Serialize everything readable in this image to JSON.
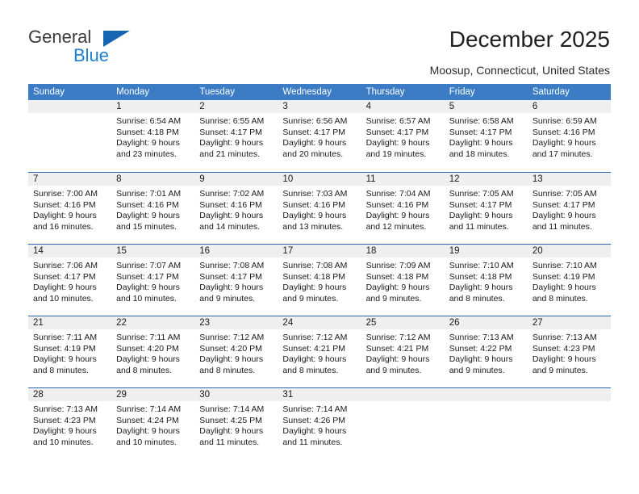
{
  "brand": {
    "name_part1": "General",
    "name_part2": "Blue",
    "accent_color": "#1b7fd4",
    "triangle_color": "#1565b0"
  },
  "header": {
    "title": "December 2025",
    "location": "Moosup, Connecticut, United States"
  },
  "calendar": {
    "header_bg": "#3b7cc4",
    "header_text_color": "#ffffff",
    "day_band_bg": "#efefef",
    "weekdays": [
      "Sunday",
      "Monday",
      "Tuesday",
      "Wednesday",
      "Thursday",
      "Friday",
      "Saturday"
    ],
    "weeks": [
      [
        {
          "number": "",
          "sunrise": "",
          "sunset": "",
          "daylight_line1": "",
          "daylight_line2": ""
        },
        {
          "number": "1",
          "sunrise": "Sunrise: 6:54 AM",
          "sunset": "Sunset: 4:18 PM",
          "daylight_line1": "Daylight: 9 hours",
          "daylight_line2": "and 23 minutes."
        },
        {
          "number": "2",
          "sunrise": "Sunrise: 6:55 AM",
          "sunset": "Sunset: 4:17 PM",
          "daylight_line1": "Daylight: 9 hours",
          "daylight_line2": "and 21 minutes."
        },
        {
          "number": "3",
          "sunrise": "Sunrise: 6:56 AM",
          "sunset": "Sunset: 4:17 PM",
          "daylight_line1": "Daylight: 9 hours",
          "daylight_line2": "and 20 minutes."
        },
        {
          "number": "4",
          "sunrise": "Sunrise: 6:57 AM",
          "sunset": "Sunset: 4:17 PM",
          "daylight_line1": "Daylight: 9 hours",
          "daylight_line2": "and 19 minutes."
        },
        {
          "number": "5",
          "sunrise": "Sunrise: 6:58 AM",
          "sunset": "Sunset: 4:17 PM",
          "daylight_line1": "Daylight: 9 hours",
          "daylight_line2": "and 18 minutes."
        },
        {
          "number": "6",
          "sunrise": "Sunrise: 6:59 AM",
          "sunset": "Sunset: 4:16 PM",
          "daylight_line1": "Daylight: 9 hours",
          "daylight_line2": "and 17 minutes."
        }
      ],
      [
        {
          "number": "7",
          "sunrise": "Sunrise: 7:00 AM",
          "sunset": "Sunset: 4:16 PM",
          "daylight_line1": "Daylight: 9 hours",
          "daylight_line2": "and 16 minutes."
        },
        {
          "number": "8",
          "sunrise": "Sunrise: 7:01 AM",
          "sunset": "Sunset: 4:16 PM",
          "daylight_line1": "Daylight: 9 hours",
          "daylight_line2": "and 15 minutes."
        },
        {
          "number": "9",
          "sunrise": "Sunrise: 7:02 AM",
          "sunset": "Sunset: 4:16 PM",
          "daylight_line1": "Daylight: 9 hours",
          "daylight_line2": "and 14 minutes."
        },
        {
          "number": "10",
          "sunrise": "Sunrise: 7:03 AM",
          "sunset": "Sunset: 4:16 PM",
          "daylight_line1": "Daylight: 9 hours",
          "daylight_line2": "and 13 minutes."
        },
        {
          "number": "11",
          "sunrise": "Sunrise: 7:04 AM",
          "sunset": "Sunset: 4:16 PM",
          "daylight_line1": "Daylight: 9 hours",
          "daylight_line2": "and 12 minutes."
        },
        {
          "number": "12",
          "sunrise": "Sunrise: 7:05 AM",
          "sunset": "Sunset: 4:17 PM",
          "daylight_line1": "Daylight: 9 hours",
          "daylight_line2": "and 11 minutes."
        },
        {
          "number": "13",
          "sunrise": "Sunrise: 7:05 AM",
          "sunset": "Sunset: 4:17 PM",
          "daylight_line1": "Daylight: 9 hours",
          "daylight_line2": "and 11 minutes."
        }
      ],
      [
        {
          "number": "14",
          "sunrise": "Sunrise: 7:06 AM",
          "sunset": "Sunset: 4:17 PM",
          "daylight_line1": "Daylight: 9 hours",
          "daylight_line2": "and 10 minutes."
        },
        {
          "number": "15",
          "sunrise": "Sunrise: 7:07 AM",
          "sunset": "Sunset: 4:17 PM",
          "daylight_line1": "Daylight: 9 hours",
          "daylight_line2": "and 10 minutes."
        },
        {
          "number": "16",
          "sunrise": "Sunrise: 7:08 AM",
          "sunset": "Sunset: 4:17 PM",
          "daylight_line1": "Daylight: 9 hours",
          "daylight_line2": "and 9 minutes."
        },
        {
          "number": "17",
          "sunrise": "Sunrise: 7:08 AM",
          "sunset": "Sunset: 4:18 PM",
          "daylight_line1": "Daylight: 9 hours",
          "daylight_line2": "and 9 minutes."
        },
        {
          "number": "18",
          "sunrise": "Sunrise: 7:09 AM",
          "sunset": "Sunset: 4:18 PM",
          "daylight_line1": "Daylight: 9 hours",
          "daylight_line2": "and 9 minutes."
        },
        {
          "number": "19",
          "sunrise": "Sunrise: 7:10 AM",
          "sunset": "Sunset: 4:18 PM",
          "daylight_line1": "Daylight: 9 hours",
          "daylight_line2": "and 8 minutes."
        },
        {
          "number": "20",
          "sunrise": "Sunrise: 7:10 AM",
          "sunset": "Sunset: 4:19 PM",
          "daylight_line1": "Daylight: 9 hours",
          "daylight_line2": "and 8 minutes."
        }
      ],
      [
        {
          "number": "21",
          "sunrise": "Sunrise: 7:11 AM",
          "sunset": "Sunset: 4:19 PM",
          "daylight_line1": "Daylight: 9 hours",
          "daylight_line2": "and 8 minutes."
        },
        {
          "number": "22",
          "sunrise": "Sunrise: 7:11 AM",
          "sunset": "Sunset: 4:20 PM",
          "daylight_line1": "Daylight: 9 hours",
          "daylight_line2": "and 8 minutes."
        },
        {
          "number": "23",
          "sunrise": "Sunrise: 7:12 AM",
          "sunset": "Sunset: 4:20 PM",
          "daylight_line1": "Daylight: 9 hours",
          "daylight_line2": "and 8 minutes."
        },
        {
          "number": "24",
          "sunrise": "Sunrise: 7:12 AM",
          "sunset": "Sunset: 4:21 PM",
          "daylight_line1": "Daylight: 9 hours",
          "daylight_line2": "and 8 minutes."
        },
        {
          "number": "25",
          "sunrise": "Sunrise: 7:12 AM",
          "sunset": "Sunset: 4:21 PM",
          "daylight_line1": "Daylight: 9 hours",
          "daylight_line2": "and 9 minutes."
        },
        {
          "number": "26",
          "sunrise": "Sunrise: 7:13 AM",
          "sunset": "Sunset: 4:22 PM",
          "daylight_line1": "Daylight: 9 hours",
          "daylight_line2": "and 9 minutes."
        },
        {
          "number": "27",
          "sunrise": "Sunrise: 7:13 AM",
          "sunset": "Sunset: 4:23 PM",
          "daylight_line1": "Daylight: 9 hours",
          "daylight_line2": "and 9 minutes."
        }
      ],
      [
        {
          "number": "28",
          "sunrise": "Sunrise: 7:13 AM",
          "sunset": "Sunset: 4:23 PM",
          "daylight_line1": "Daylight: 9 hours",
          "daylight_line2": "and 10 minutes."
        },
        {
          "number": "29",
          "sunrise": "Sunrise: 7:14 AM",
          "sunset": "Sunset: 4:24 PM",
          "daylight_line1": "Daylight: 9 hours",
          "daylight_line2": "and 10 minutes."
        },
        {
          "number": "30",
          "sunrise": "Sunrise: 7:14 AM",
          "sunset": "Sunset: 4:25 PM",
          "daylight_line1": "Daylight: 9 hours",
          "daylight_line2": "and 11 minutes."
        },
        {
          "number": "31",
          "sunrise": "Sunrise: 7:14 AM",
          "sunset": "Sunset: 4:26 PM",
          "daylight_line1": "Daylight: 9 hours",
          "daylight_line2": "and 11 minutes."
        },
        {
          "number": "",
          "sunrise": "",
          "sunset": "",
          "daylight_line1": "",
          "daylight_line2": ""
        },
        {
          "number": "",
          "sunrise": "",
          "sunset": "",
          "daylight_line1": "",
          "daylight_line2": ""
        },
        {
          "number": "",
          "sunrise": "",
          "sunset": "",
          "daylight_line1": "",
          "daylight_line2": ""
        }
      ]
    ]
  }
}
